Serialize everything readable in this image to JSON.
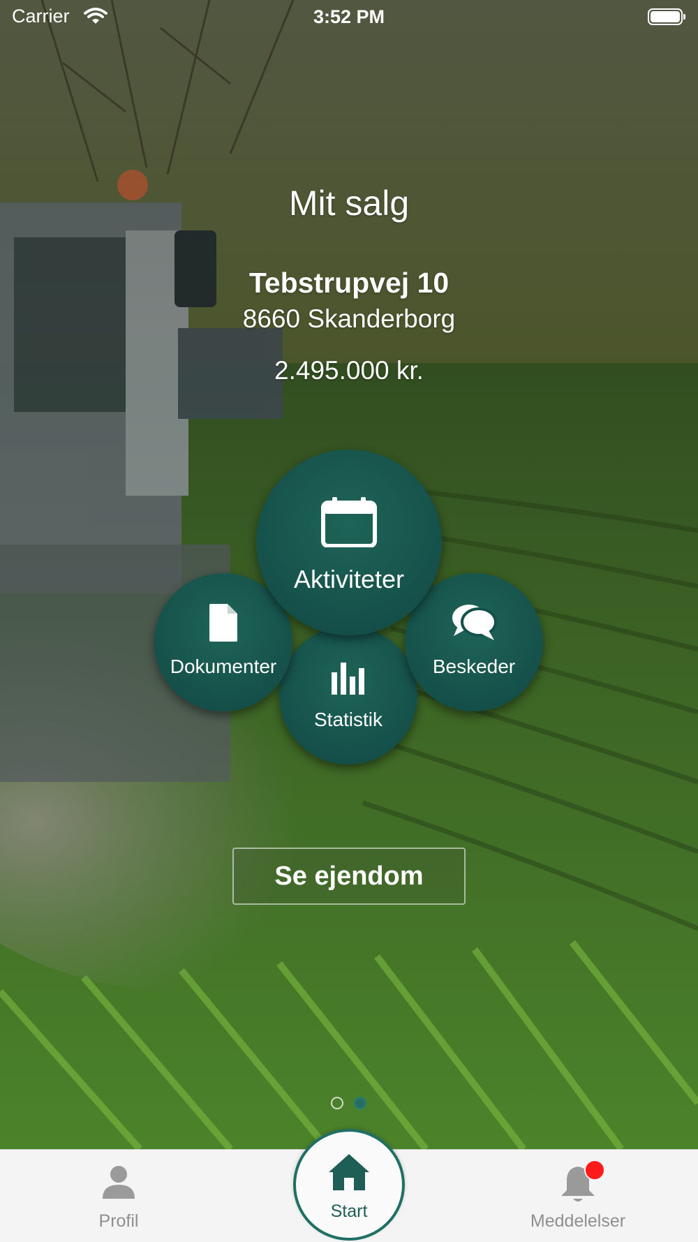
{
  "status_bar": {
    "carrier": "Carrier",
    "time": "3:52 PM"
  },
  "sale": {
    "title": "Mit salg",
    "street": "Tebstrupvej 10",
    "city": "8660 Skanderborg",
    "price": "2.495.000 kr."
  },
  "menu": {
    "aktiviteter": {
      "label": "Aktiviteter",
      "icon": "calendar-icon"
    },
    "dokumenter": {
      "label": "Dokumenter",
      "icon": "document-icon"
    },
    "beskeder": {
      "label": "Beskeder",
      "icon": "chat-bubbles-icon"
    },
    "statistik": {
      "label": "Statistik",
      "icon": "bar-chart-icon"
    }
  },
  "property_button": {
    "label": "Se ejendom"
  },
  "page_indicator": {
    "count": 2,
    "active": 2
  },
  "tabbar": {
    "profil": {
      "label": "Profil",
      "icon": "person-icon"
    },
    "start": {
      "label": "Start",
      "icon": "home-icon"
    },
    "meddelelser": {
      "label": "Meddelelser",
      "icon": "bell-icon",
      "has_badge": true
    }
  },
  "colors": {
    "accent": "#15504a",
    "badge": "#ff1a1a",
    "tabbar_bg": "#f4f4f4"
  }
}
